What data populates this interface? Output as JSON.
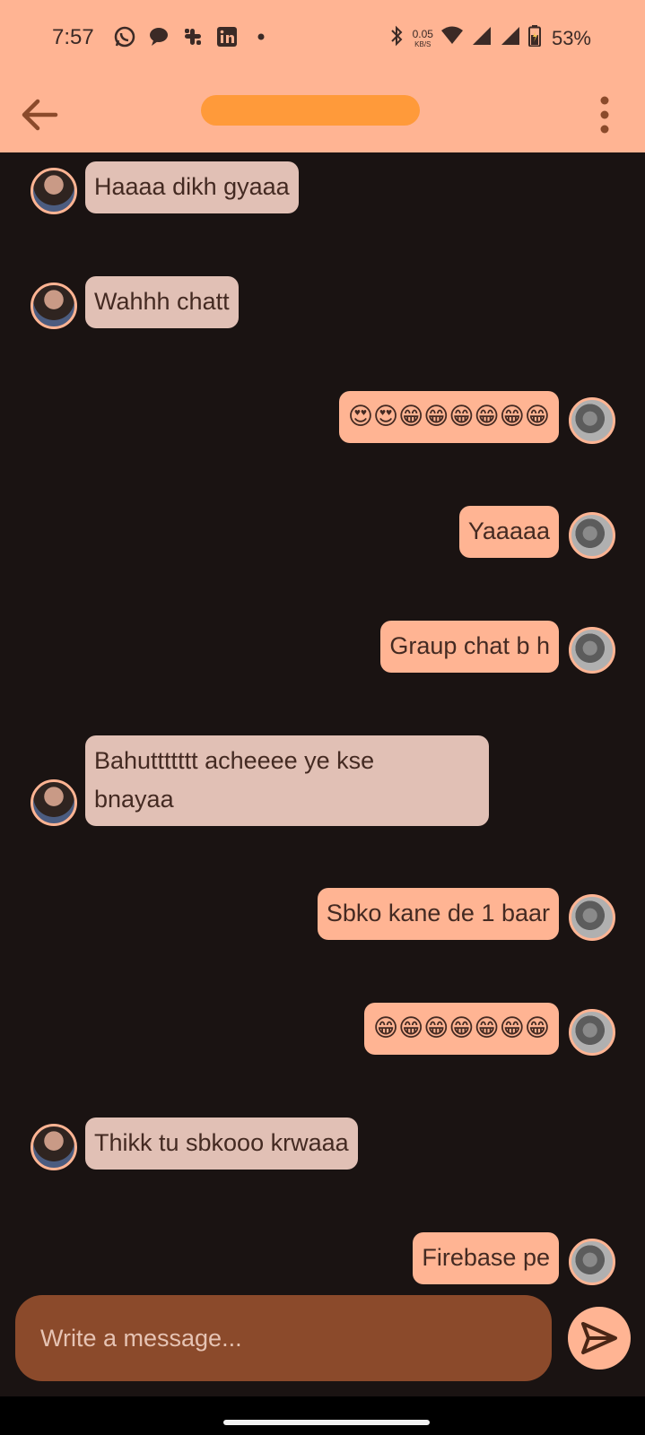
{
  "status_bar": {
    "time": "7:57",
    "notifications": [
      "whatsapp-icon",
      "chat-bubble-icon",
      "slack-icon",
      "linkedin-icon",
      "dot-icon"
    ],
    "net_speed_value": "0.05",
    "net_speed_unit": "KB/S",
    "battery": "53%"
  },
  "appbar": {
    "back_icon": "arrow-left-icon",
    "menu_icon": "more-vert-icon"
  },
  "messages": [
    {
      "from": "her",
      "text": "Haaaa dikh gyaaa"
    },
    {
      "from": "her",
      "text": "Wahhh chatt"
    },
    {
      "from": "me",
      "text": "😍😍😁😁😁😁😁😁"
    },
    {
      "from": "me",
      "text": "Yaaaaa"
    },
    {
      "from": "me",
      "text": "Graup chat b h"
    },
    {
      "from": "her",
      "text": "Bahuttttttt acheeee ye kse\nbnayaa"
    },
    {
      "from": "me",
      "text": "Sbko kane de 1 baar"
    },
    {
      "from": "me",
      "text": "😁😁😁😁😁😁😁"
    },
    {
      "from": "her",
      "text": "Thikk tu sbkooo krwaaa"
    },
    {
      "from": "me",
      "text": "Firebase pe"
    }
  ],
  "composer": {
    "placeholder": "Write a message...",
    "value": ""
  },
  "colors": {
    "accent": "#ffb493",
    "incoming_bubble": "#e1c0b5",
    "composer_bg": "#8b4a2b",
    "background": "#1a1312"
  }
}
